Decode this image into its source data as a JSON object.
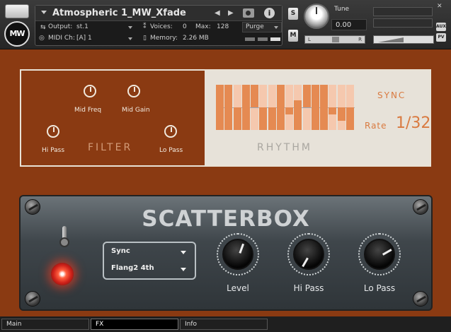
{
  "header": {
    "instrument_name": "Atmospheric 1_MW_Xfade",
    "output_label": "Output:",
    "output_value": "st.1",
    "voices_label": "Voices:",
    "voices_value": "0",
    "max_label": "Max:",
    "max_value": "128",
    "purge_label": "Purge",
    "midi_label": "MIDI Ch:",
    "midi_value": "[A]  1",
    "memory_label": "Memory:",
    "memory_value": "2.26 MB",
    "solo_label": "S",
    "mute_label": "M",
    "tune_label": "Tune",
    "tune_value": "0.00",
    "pan_left": "L",
    "pan_right": "R",
    "aux_label": "AUX",
    "pv_label": "PV",
    "logo_text": "MW"
  },
  "filter": {
    "title": "FILTER",
    "mid_freq_label": "Mid Freq",
    "mid_gain_label": "Mid Gain",
    "hi_pass_label": "Hi Pass",
    "lo_pass_label": "Lo Pass"
  },
  "rhythm": {
    "title": "RHYTHM",
    "sync_label": "SYNC",
    "rate_label": "Rate",
    "rate_value": "1/32",
    "steps": [
      {
        "up": 1.0,
        "down": 1.0
      },
      {
        "up": 1.0,
        "down": 1.0
      },
      {
        "up": 0.0,
        "down": 1.0
      },
      {
        "up": 1.0,
        "down": 1.0
      },
      {
        "up": 1.0,
        "down": 0.0
      },
      {
        "up": 0.0,
        "down": 1.0
      },
      {
        "up": 0.0,
        "down": 1.0
      },
      {
        "up": 1.0,
        "down": 1.0
      },
      {
        "up": 0.0,
        "down": 0.3
      },
      {
        "up": 0.3,
        "down": 1.0
      },
      {
        "up": 1.0,
        "down": 0.0
      },
      {
        "up": 1.0,
        "down": 1.0
      },
      {
        "up": 1.0,
        "down": 1.0
      },
      {
        "up": 0.0,
        "down": 0.3
      },
      {
        "up": 0.0,
        "down": 0.6
      },
      {
        "up": 0.0,
        "down": 1.0
      }
    ]
  },
  "scatterbox": {
    "title": "SCATTERBOX",
    "dropdown_1": "Sync",
    "dropdown_2": "Flang2 4th",
    "level_label": "Level",
    "hipass_label": "Hi Pass",
    "lopass_label": "Lo Pass"
  },
  "tabs": [
    {
      "label": "Main"
    },
    {
      "label": "FX"
    },
    {
      "label": "Info"
    }
  ],
  "colors": {
    "accent": "#d97a40",
    "background": "#8a3a12",
    "rhythm_bg": "#e7e2d9"
  }
}
